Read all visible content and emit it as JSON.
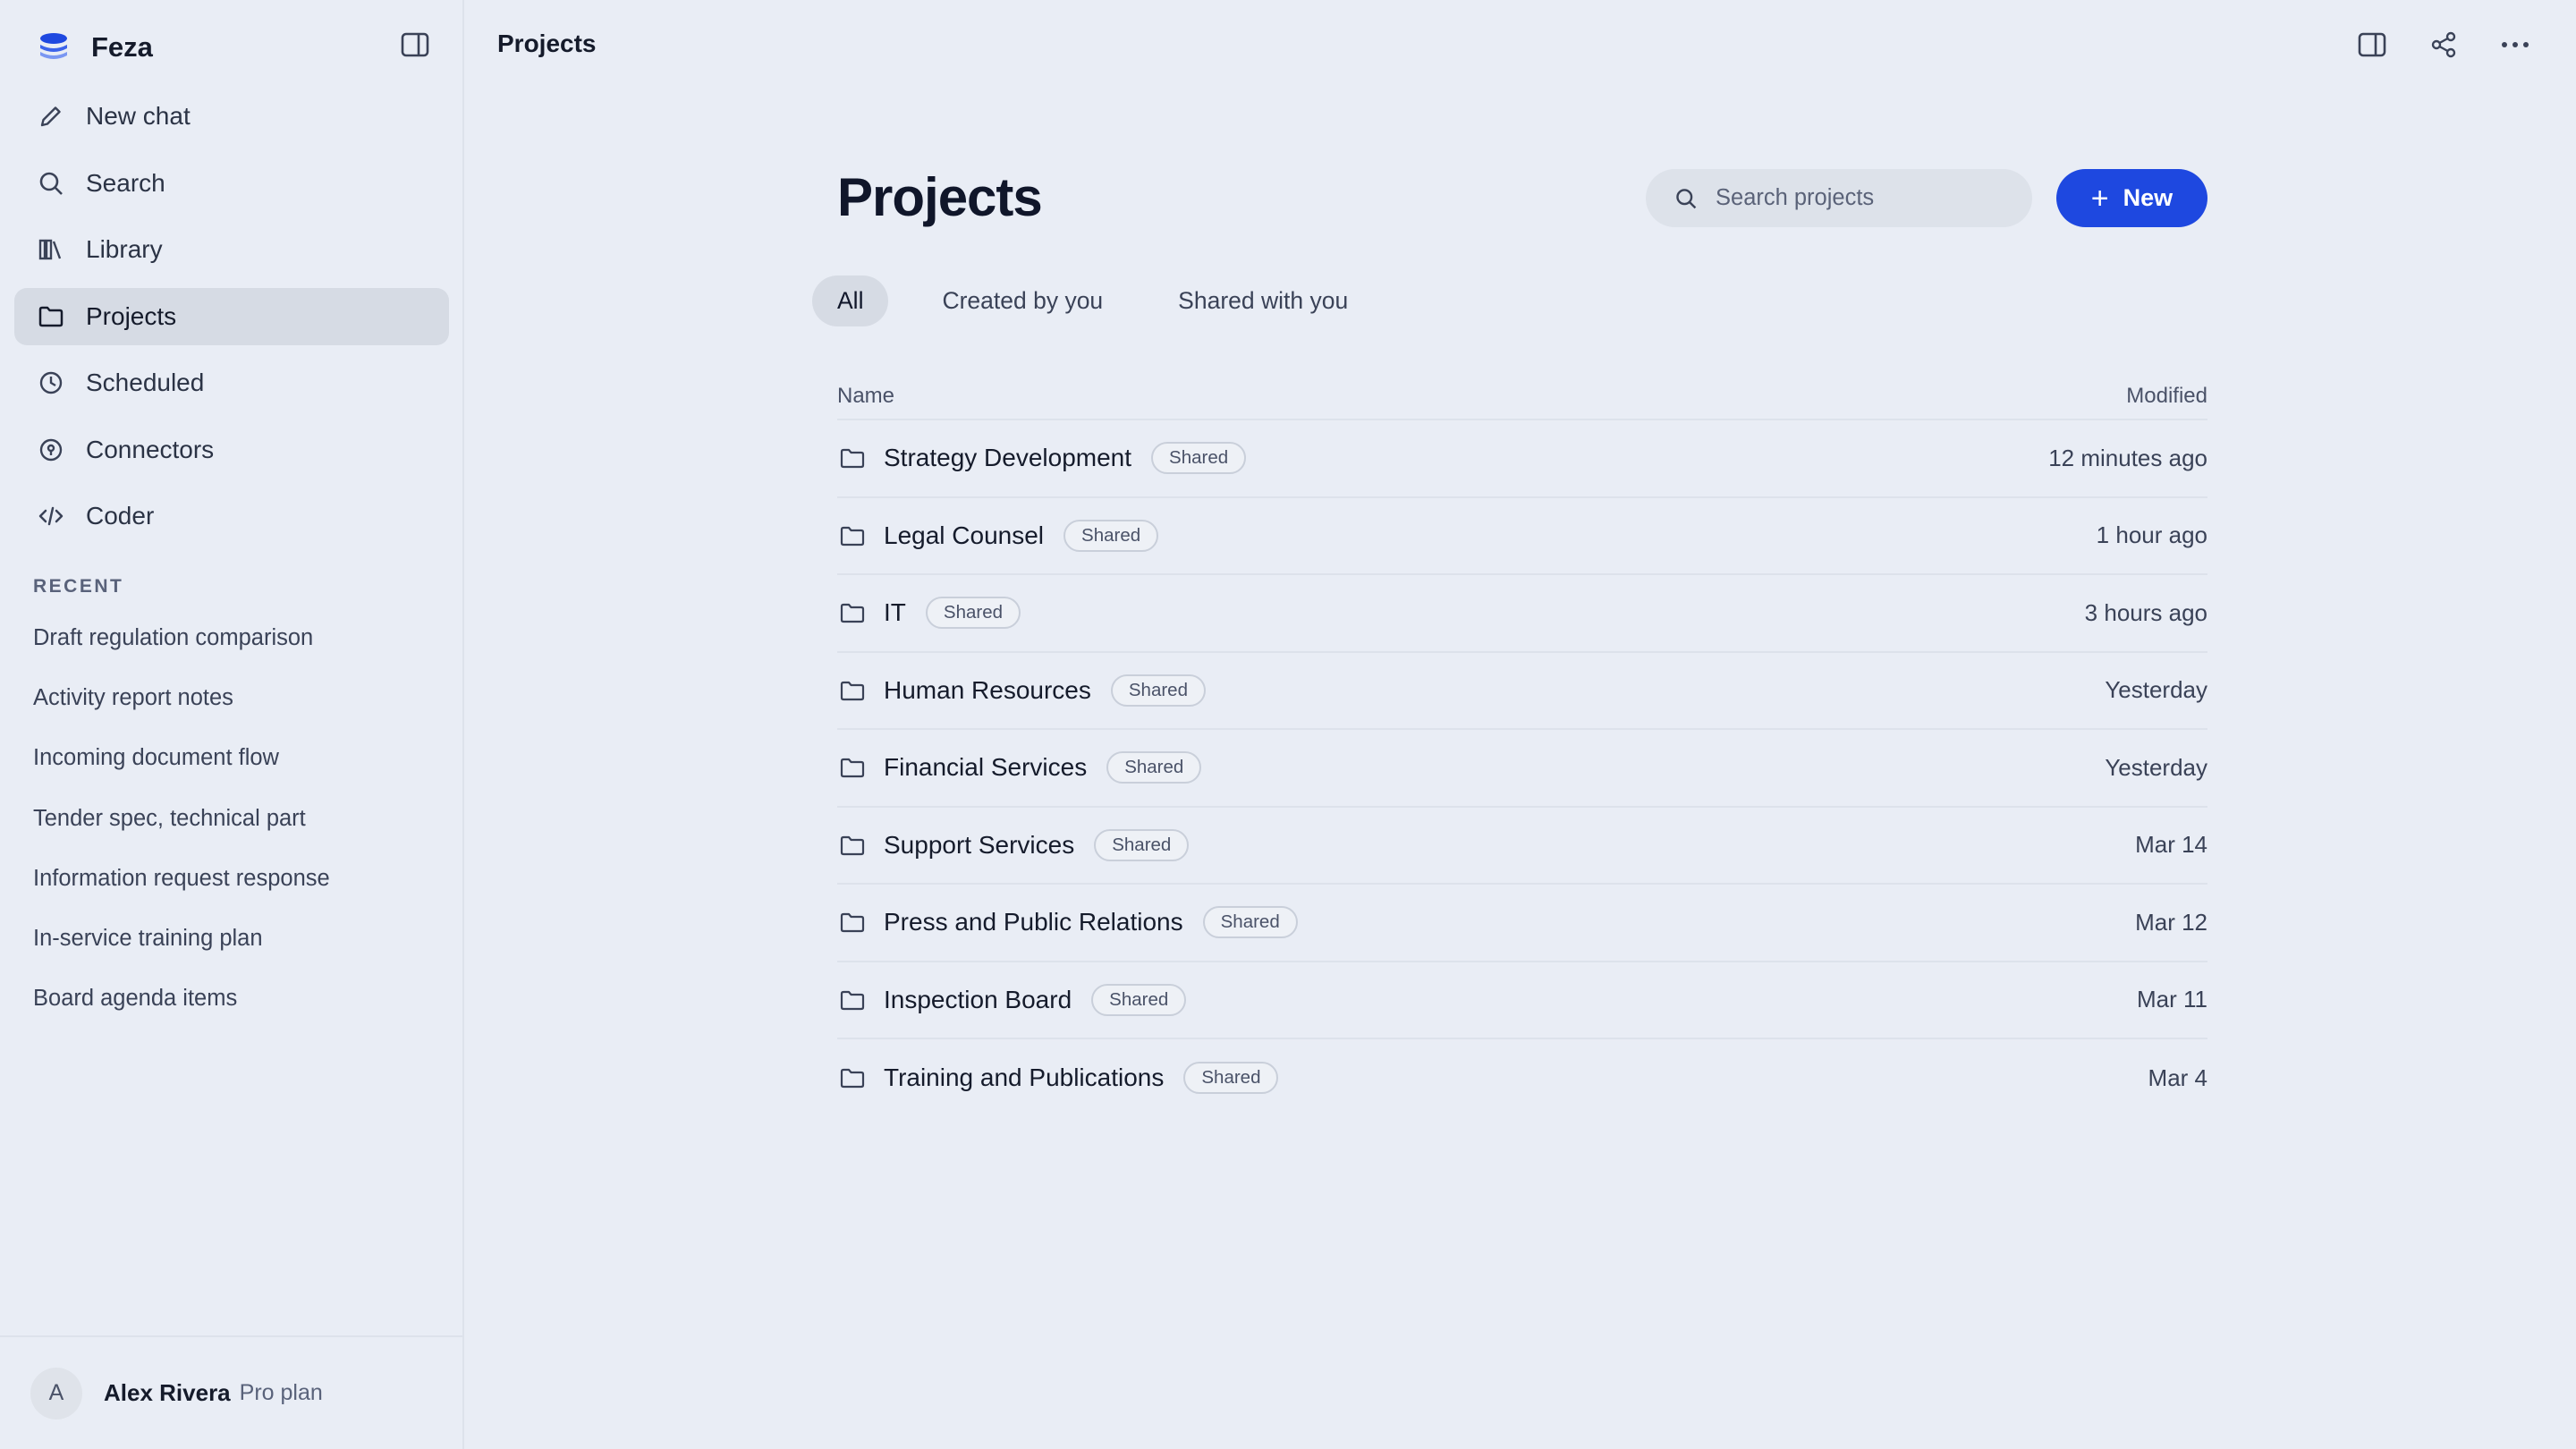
{
  "app": {
    "name": "Feza"
  },
  "sidebar": {
    "nav": [
      {
        "label": "New chat",
        "icon": "pencil-icon"
      },
      {
        "label": "Search",
        "icon": "search-icon"
      },
      {
        "label": "Library",
        "icon": "library-icon"
      },
      {
        "label": "Projects",
        "icon": "folder-icon",
        "active": true
      },
      {
        "label": "Scheduled",
        "icon": "clock-icon"
      },
      {
        "label": "Connectors",
        "icon": "connector-icon"
      },
      {
        "label": "Coder",
        "icon": "code-icon"
      }
    ],
    "recent_header": "RECENT",
    "recent": [
      "Draft regulation comparison",
      "Activity report notes",
      "Incoming document flow",
      "Tender spec, technical part",
      "Information request response",
      "In-service training plan",
      "Board agenda items"
    ],
    "user": {
      "initial": "A",
      "name": "Alex Rivera",
      "plan": "Pro plan"
    }
  },
  "topbar": {
    "title": "Projects"
  },
  "main": {
    "title": "Projects",
    "search": {
      "placeholder": "Search projects"
    },
    "new_button": "New",
    "tabs": [
      "All",
      "Created by you",
      "Shared with you"
    ],
    "columns": {
      "name": "Name",
      "modified": "Modified"
    },
    "rows": [
      {
        "name": "Strategy Development",
        "badge": "Shared",
        "modified": "12 minutes ago"
      },
      {
        "name": "Legal Counsel",
        "badge": "Shared",
        "modified": "1 hour ago"
      },
      {
        "name": "IT",
        "badge": "Shared",
        "modified": "3 hours ago"
      },
      {
        "name": "Human Resources",
        "badge": "Shared",
        "modified": "Yesterday"
      },
      {
        "name": "Financial Services",
        "badge": "Shared",
        "modified": "Yesterday"
      },
      {
        "name": "Support Services",
        "badge": "Shared",
        "modified": "Mar 14"
      },
      {
        "name": "Press and Public Relations",
        "badge": "Shared",
        "modified": "Mar 12"
      },
      {
        "name": "Inspection Board",
        "badge": "Shared",
        "modified": "Mar 11"
      },
      {
        "name": "Training and Publications",
        "badge": "Shared",
        "modified": "Mar 4"
      }
    ]
  },
  "colors": {
    "accent": "#1e48e0",
    "background": "#e9edf5",
    "active_item": "#d6dbe4"
  }
}
